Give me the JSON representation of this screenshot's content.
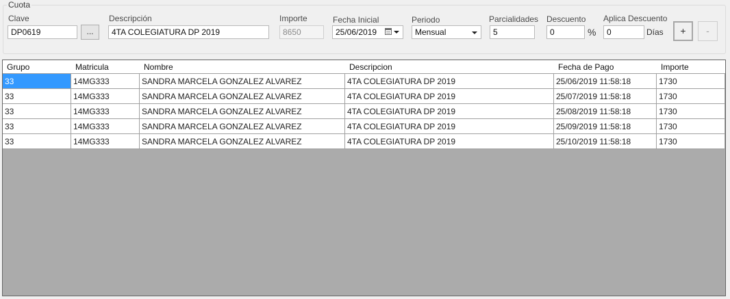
{
  "group": {
    "title": "Cuota",
    "clave": {
      "label": "Clave",
      "value": "DP0619",
      "browse_label": "..."
    },
    "descripcion": {
      "label": "Descripción",
      "value": "4TA COLEGIATURA DP 2019"
    },
    "importe": {
      "label": "Importe",
      "value": "8650"
    },
    "fecha_inicial": {
      "label": "Fecha Inicial",
      "value": "25/06/2019"
    },
    "periodo": {
      "label": "Periodo",
      "value": "Mensual"
    },
    "parcialidades": {
      "label": "Parcialidades",
      "value": "5"
    },
    "descuento": {
      "label": "Descuento",
      "value": "0",
      "unit": "%"
    },
    "aplica_descuento": {
      "label": "Aplica Descuento",
      "value": "0",
      "unit": "Días"
    },
    "add_label": "+",
    "remove_label": "-"
  },
  "grid": {
    "columns": [
      "Grupo",
      "Matricula",
      "Nombre",
      "Descripcion",
      "Fecha de Pago",
      "Importe"
    ],
    "rows": [
      [
        "33",
        "14MG333",
        "SANDRA MARCELA GONZALEZ ALVAREZ",
        "4TA COLEGIATURA DP 2019",
        "25/06/2019 11:58:18",
        "1730"
      ],
      [
        "33",
        "14MG333",
        "SANDRA MARCELA GONZALEZ ALVAREZ",
        "4TA COLEGIATURA DP 2019",
        "25/07/2019 11:58:18",
        "1730"
      ],
      [
        "33",
        "14MG333",
        "SANDRA MARCELA GONZALEZ ALVAREZ",
        "4TA COLEGIATURA DP 2019",
        "25/08/2019 11:58:18",
        "1730"
      ],
      [
        "33",
        "14MG333",
        "SANDRA MARCELA GONZALEZ ALVAREZ",
        "4TA COLEGIATURA DP 2019",
        "25/09/2019 11:58:18",
        "1730"
      ],
      [
        "33",
        "14MG333",
        "SANDRA MARCELA GONZALEZ ALVAREZ",
        "4TA COLEGIATURA DP 2019",
        "25/10/2019 11:58:18",
        "1730"
      ]
    ],
    "selected_row": 0,
    "selected_col": 0
  }
}
